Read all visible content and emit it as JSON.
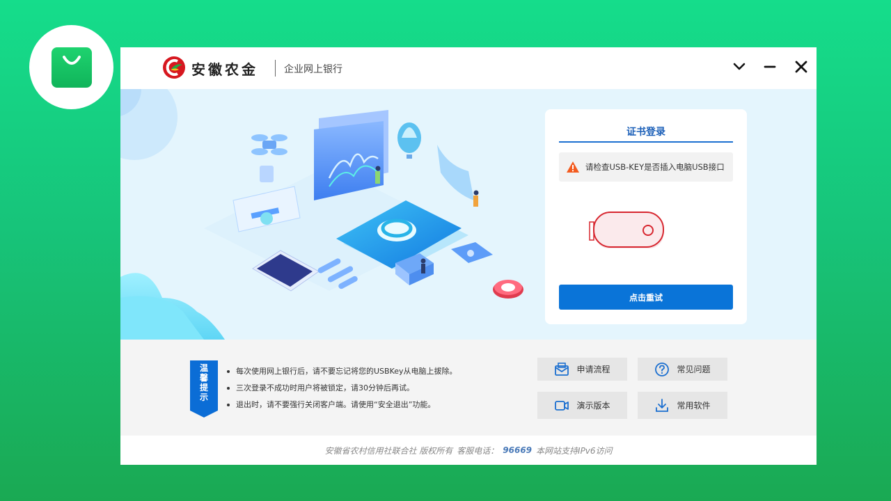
{
  "app_icon": {
    "name": "shopping-bag-icon",
    "color": "#1ed36f"
  },
  "window": {
    "brand_name": "安徽农金",
    "sub_brand": "企业网上银行",
    "controls": [
      "chevron-down-icon",
      "minimize-icon",
      "close-icon"
    ]
  },
  "login_card": {
    "tab_label": "证书登录",
    "warning_text": "请检查USB-KEY是否插入电脑USB接口",
    "retry_label": "点击重试",
    "accent_color": "#0a74d8"
  },
  "tips": {
    "ribbon_chars": [
      "温",
      "馨",
      "提",
      "示"
    ],
    "items": [
      "每次使用网上银行后，请不要忘记将您的USBKey从电脑上拔除。",
      "三次登录不成功时用户将被锁定，请30分钟后再试。",
      "退出时，请不要强行关闭客户端。请使用“安全退出”功能。"
    ]
  },
  "quick_links": [
    {
      "label": "申请流程",
      "icon": "envelope-icon"
    },
    {
      "label": "常见问题",
      "icon": "question-circle-icon"
    },
    {
      "label": "演示版本",
      "icon": "video-camera-icon"
    },
    {
      "label": "常用软件",
      "icon": "download-icon"
    }
  ],
  "footer": {
    "copyright": "安徽省农村信用社联合社 版权所有",
    "service_label": "客服电话：",
    "phone": "96669",
    "ipv6_note": "本网站支持IPv6访问"
  }
}
